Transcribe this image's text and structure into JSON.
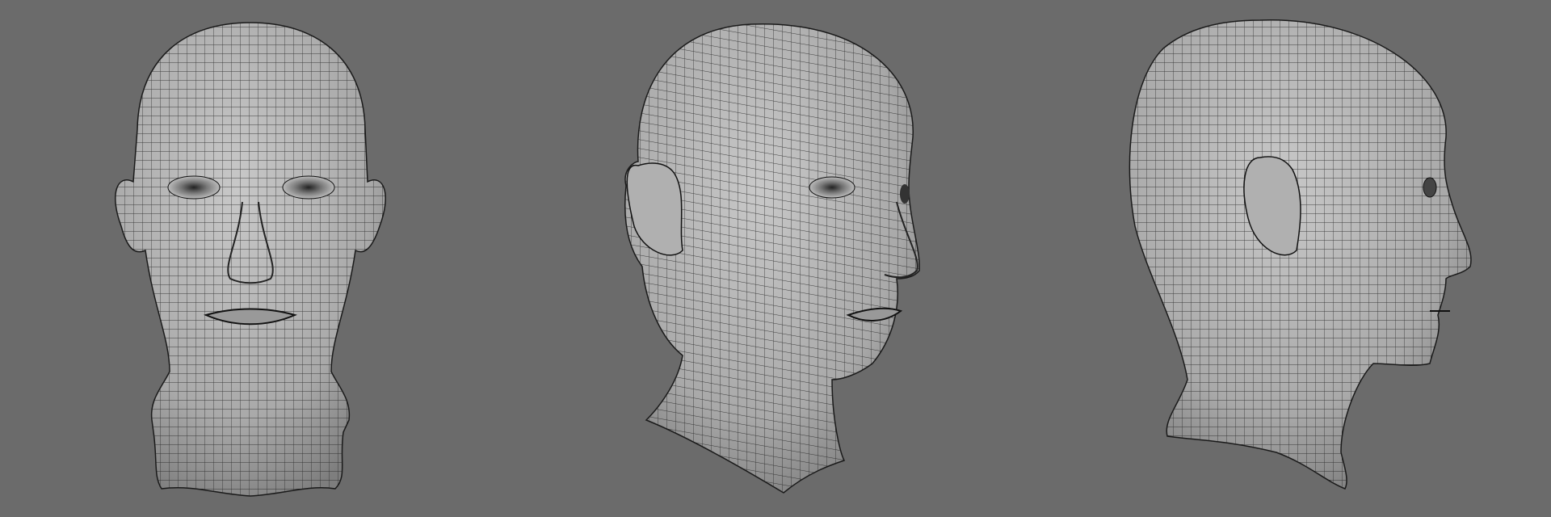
{
  "scene": {
    "views": [
      {
        "name": "front"
      },
      {
        "name": "three-quarter"
      },
      {
        "name": "profile"
      }
    ],
    "colors": {
      "background": "#6b6b6b",
      "surface": "#bdbdbd",
      "surface_shade": "#8e8e8e",
      "wire": "#1e1e1e"
    }
  }
}
